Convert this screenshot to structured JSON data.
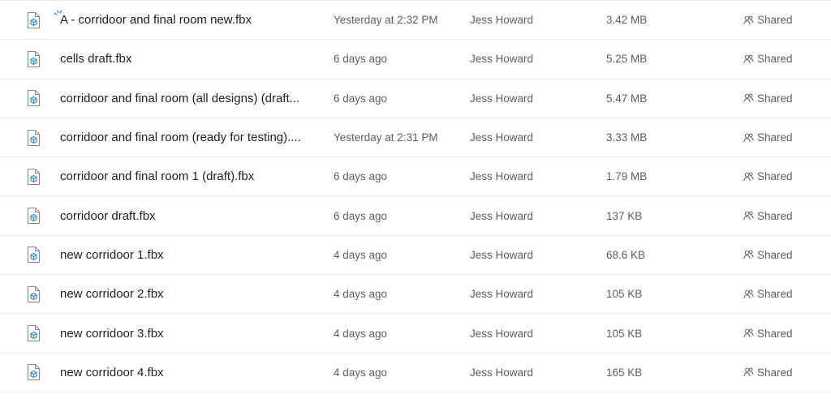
{
  "files": [
    {
      "name": "A - corridoor and final room new.fbx",
      "modified": "Yesterday at 2:32 PM",
      "modified_by": "Jess Howard",
      "size": "3.42 MB",
      "sharing": "Shared",
      "icon": "3d-file-icon",
      "is_new": true
    },
    {
      "name": "cells draft.fbx",
      "modified": "6 days ago",
      "modified_by": "Jess Howard",
      "size": "5.25 MB",
      "sharing": "Shared",
      "icon": "3d-file-icon",
      "is_new": false
    },
    {
      "name": "corridoor and final room (all designs) (draft...",
      "modified": "6 days ago",
      "modified_by": "Jess Howard",
      "size": "5.47 MB",
      "sharing": "Shared",
      "icon": "3d-file-icon",
      "is_new": false
    },
    {
      "name": "corridoor and final room (ready for testing)....",
      "modified": "Yesterday at 2:31 PM",
      "modified_by": "Jess Howard",
      "size": "3.33 MB",
      "sharing": "Shared",
      "icon": "3d-file-icon",
      "is_new": false
    },
    {
      "name": "corridoor and final room 1 (draft).fbx",
      "modified": "6 days ago",
      "modified_by": "Jess Howard",
      "size": "1.79 MB",
      "sharing": "Shared",
      "icon": "3d-file-icon",
      "is_new": false
    },
    {
      "name": "corridoor draft.fbx",
      "modified": "6 days ago",
      "modified_by": "Jess Howard",
      "size": "137 KB",
      "sharing": "Shared",
      "icon": "3d-file-icon",
      "is_new": false
    },
    {
      "name": "new corridoor 1.fbx",
      "modified": "4 days ago",
      "modified_by": "Jess Howard",
      "size": "68.6 KB",
      "sharing": "Shared",
      "icon": "3d-file-icon",
      "is_new": false
    },
    {
      "name": "new corridoor 2.fbx",
      "modified": "4 days ago",
      "modified_by": "Jess Howard",
      "size": "105 KB",
      "sharing": "Shared",
      "icon": "3d-file-icon",
      "is_new": false
    },
    {
      "name": "new corridoor 3.fbx",
      "modified": "4 days ago",
      "modified_by": "Jess Howard",
      "size": "105 KB",
      "sharing": "Shared",
      "icon": "3d-file-icon",
      "is_new": false
    },
    {
      "name": "new corridoor 4.fbx",
      "modified": "4 days ago",
      "modified_by": "Jess Howard",
      "size": "165 KB",
      "sharing": "Shared",
      "icon": "3d-file-icon",
      "is_new": false
    }
  ],
  "colors": {
    "icon_accent": "#2b88d8",
    "icon_outline": "#8a8886",
    "new_indicator": "#2b88d8",
    "secondary_text": "#605e5c",
    "divider": "#edebe9"
  }
}
